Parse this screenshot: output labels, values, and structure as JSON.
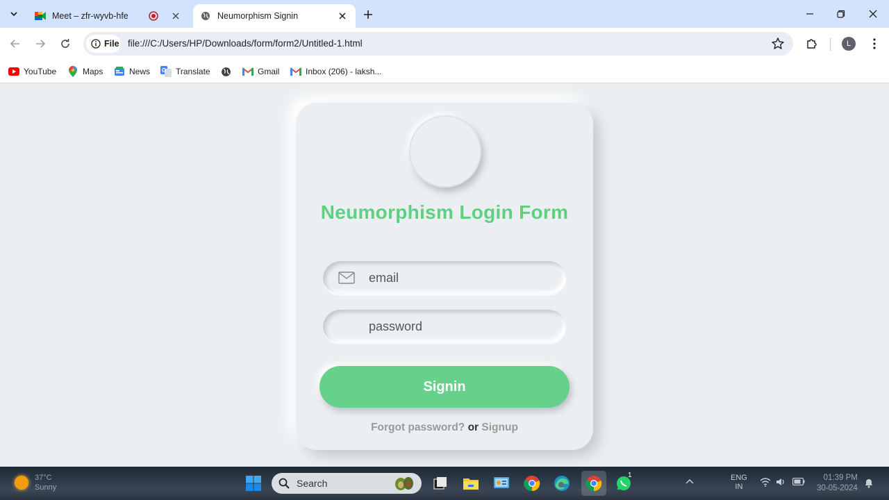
{
  "browser": {
    "tabs": [
      {
        "title": "Meet – zfr-wyvb-hfe",
        "active": false,
        "favicon": "google-meet-icon",
        "recording": true
      },
      {
        "title": "Neumorphism Signin",
        "active": true,
        "favicon": "globe-icon"
      }
    ],
    "address": {
      "chip_label": "File",
      "url": "file:///C:/Users/HP/Downloads/form/form2/Untitled-1.html"
    },
    "profile_initial": "L",
    "bookmarks": [
      {
        "label": "YouTube",
        "icon": "youtube-icon"
      },
      {
        "label": "Maps",
        "icon": "maps-icon"
      },
      {
        "label": "News",
        "icon": "news-icon"
      },
      {
        "label": "Translate",
        "icon": "translate-icon"
      },
      {
        "label": "",
        "icon": "globe-icon"
      },
      {
        "label": "Gmail",
        "icon": "gmail-icon"
      },
      {
        "label": "Inbox (206) - laksh...",
        "icon": "gmail-icon"
      }
    ]
  },
  "form": {
    "title": "Neumorphism Login Form",
    "email_placeholder": "email",
    "password_placeholder": "password",
    "signin_label": "Signin",
    "forgot_label": "Forgot password?",
    "or_label": "or",
    "signup_label": "Signup",
    "accent_color": "#66d18a"
  },
  "taskbar": {
    "weather_temp": "37°C",
    "weather_desc": "Sunny",
    "search_label": "Search",
    "whatsapp_badge": "1",
    "lang_line1": "ENG",
    "lang_line2": "IN",
    "time": "01:39 PM",
    "date": "30-05-2024"
  }
}
